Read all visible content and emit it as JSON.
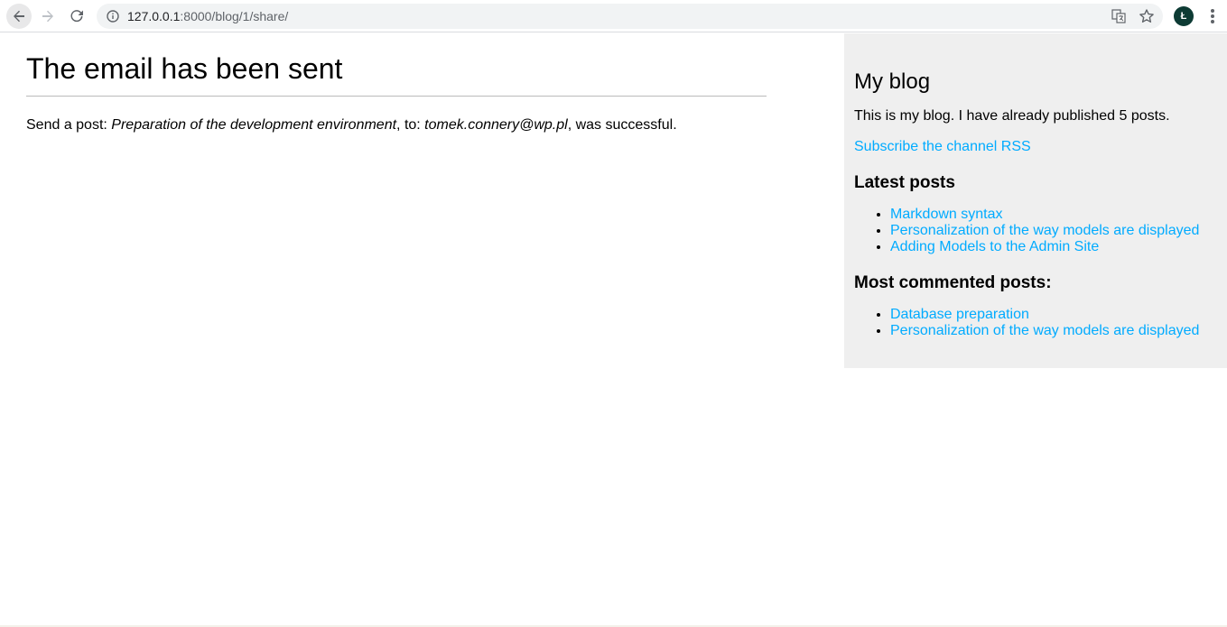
{
  "browser": {
    "url_host": "127.0.0.1",
    "url_path": ":8000/blog/1/share/",
    "profile_initial": "Ł"
  },
  "main": {
    "title": "The email has been sent",
    "message_prefix": "Send a post: ",
    "post_title": "Preparation of the development environment",
    "message_middle": ", to: ",
    "email": "tomek.connery@wp.pl",
    "message_suffix": ", was successful."
  },
  "sidebar": {
    "title": "My blog",
    "description": "This is my blog. I have already published 5 posts.",
    "rss_link": "Subscribe the channel RSS",
    "latest_title": "Latest posts",
    "latest_posts": [
      "Markdown syntax",
      "Personalization of the way models are displayed",
      "Adding Models to the Admin Site"
    ],
    "most_commented_title": "Most commented posts:",
    "most_commented_posts": [
      "Database preparation",
      "Personalization of the way models are displayed"
    ]
  },
  "colors": {
    "link": "#00abff",
    "sidebar_bg": "#efefef",
    "avatar_bg": "#0d3b34"
  }
}
